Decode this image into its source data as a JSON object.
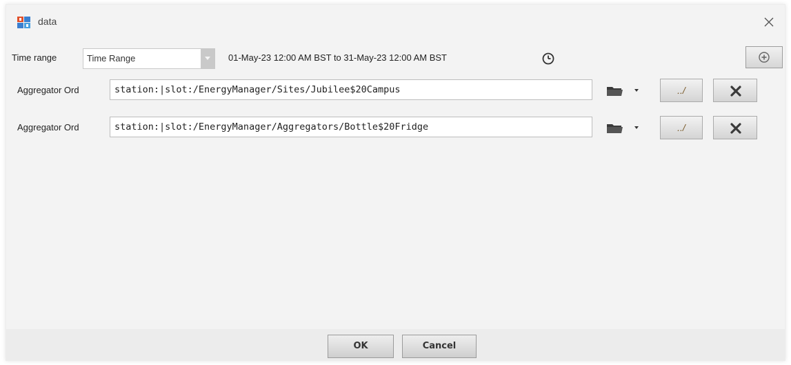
{
  "window": {
    "title": "data",
    "app_icon": "niagara-app-icon",
    "close_icon": "close-icon"
  },
  "time_range": {
    "label": "Time range",
    "select_value": "Time Range",
    "range_text": "01-May-23 12:00 AM BST to 31-May-23 12:00 AM BST",
    "clock_icon": "clock-icon",
    "add_icon": "add-circle-icon"
  },
  "aggregators": [
    {
      "label": "Aggregator Ord",
      "value": "station:|slot:/EnergyManager/Sites/Jubilee$20Campus",
      "browse_label": "../",
      "folder_icon": "folder-icon",
      "remove_icon": "remove-x-icon"
    },
    {
      "label": "Aggregator Ord",
      "value": "station:|slot:/EnergyManager/Aggregators/Bottle$20Fridge",
      "browse_label": "../",
      "folder_icon": "folder-icon",
      "remove_icon": "remove-x-icon"
    }
  ],
  "footer": {
    "ok_label": "OK",
    "cancel_label": "Cancel"
  },
  "colors": {
    "dialog_bg": "#f3f3f3",
    "footer_bg": "#ececec",
    "button_border": "#9a9a9a",
    "remove_x": "#3a3a3a"
  }
}
